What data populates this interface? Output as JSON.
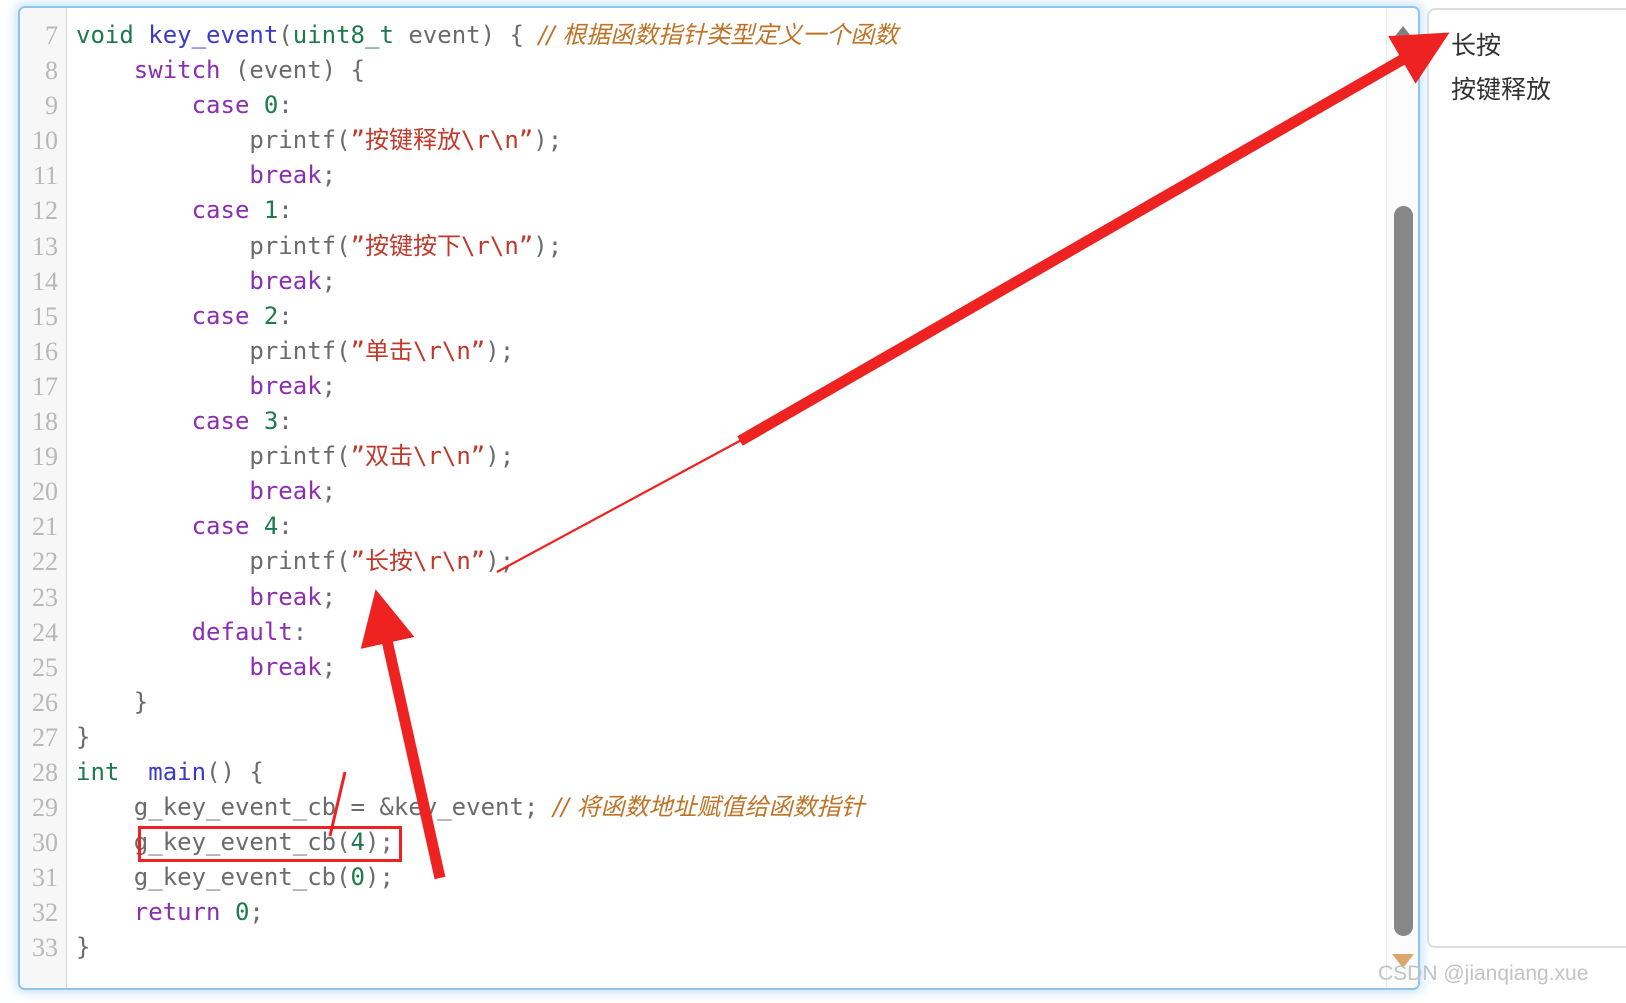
{
  "editor": {
    "gutter_start_line": 7,
    "line_numbers": [
      7,
      8,
      9,
      10,
      11,
      12,
      13,
      14,
      15,
      16,
      17,
      18,
      19,
      20,
      21,
      22,
      23,
      24,
      25,
      26,
      27,
      28,
      29,
      30,
      31,
      32,
      33
    ],
    "highlight": {
      "line": 30,
      "text": "g_key_event_cb(4);",
      "color": "#ef2222"
    },
    "colors": {
      "keyword": "#8b2fb0",
      "type": "#1d7a4d",
      "function": "#3a3ac8",
      "number": "#1d7a4d",
      "string": "#c0392b",
      "comment": "#bf7326",
      "plain": "#6b6b6b",
      "gutter_text": "#b8b8b8",
      "panel_border": "#8fc4ef"
    },
    "lines": [
      {
        "n": 7,
        "code": "void key_event(uint8_t event) { // 根据函数指针类型定义一个函数"
      },
      {
        "n": 8,
        "code": "    switch (event) {"
      },
      {
        "n": 9,
        "code": "        case 0:"
      },
      {
        "n": 10,
        "code": "            printf(\"按键释放\\r\\n\");"
      },
      {
        "n": 11,
        "code": "            break;"
      },
      {
        "n": 12,
        "code": "        case 1:"
      },
      {
        "n": 13,
        "code": "            printf(\"按键按下\\r\\n\");"
      },
      {
        "n": 14,
        "code": "            break;"
      },
      {
        "n": 15,
        "code": "        case 2:"
      },
      {
        "n": 16,
        "code": "            printf(\"单击\\r\\n\");"
      },
      {
        "n": 17,
        "code": "            break;"
      },
      {
        "n": 18,
        "code": "        case 3:"
      },
      {
        "n": 19,
        "code": "            printf(\"双击\\r\\n\");"
      },
      {
        "n": 20,
        "code": "            break;"
      },
      {
        "n": 21,
        "code": "        case 4:"
      },
      {
        "n": 22,
        "code": "            printf(\"长按\\r\\n\");"
      },
      {
        "n": 23,
        "code": "            break;"
      },
      {
        "n": 24,
        "code": "        default:"
      },
      {
        "n": 25,
        "code": "            break;"
      },
      {
        "n": 26,
        "code": "    }"
      },
      {
        "n": 27,
        "code": "}"
      },
      {
        "n": 28,
        "code": "int  main() {"
      },
      {
        "n": 29,
        "code": "    g_key_event_cb = &key_event; // 将函数地址赋值给函数指针"
      },
      {
        "n": 30,
        "code": "    g_key_event_cb(4);"
      },
      {
        "n": 31,
        "code": "    g_key_event_cb(0);"
      },
      {
        "n": 32,
        "code": "    return 0;"
      },
      {
        "n": 33,
        "code": "}"
      }
    ],
    "comments": {
      "line7": "// 根据函数指针类型定义一个函数",
      "line29": "// 将函数地址赋值给函数指针"
    },
    "strings": {
      "case0": "按键释放",
      "case1": "按键按下",
      "case2": "单击",
      "case3": "双击",
      "case4": "长按"
    }
  },
  "scrollbar": {
    "up_arrow_icon": "triangle-up-icon",
    "down_arrow_icon": "triangle-down-icon",
    "thumb_icon": "scrollbar-thumb",
    "up_arrow_color": "#808080",
    "down_arrow_color": "#dba66b",
    "thumb_color": "#878787"
  },
  "output_panel": {
    "lines": [
      "长按",
      "按键释放"
    ]
  },
  "annotations": {
    "arrow_color": "#ef2222",
    "arrow_1_label": "arrow-from-long-press-string-to-output",
    "arrow_2_label": "arrow-from-highlighted-call-to-long-press-string"
  },
  "watermark": {
    "text": "CSDN @jianqiang.xue"
  }
}
